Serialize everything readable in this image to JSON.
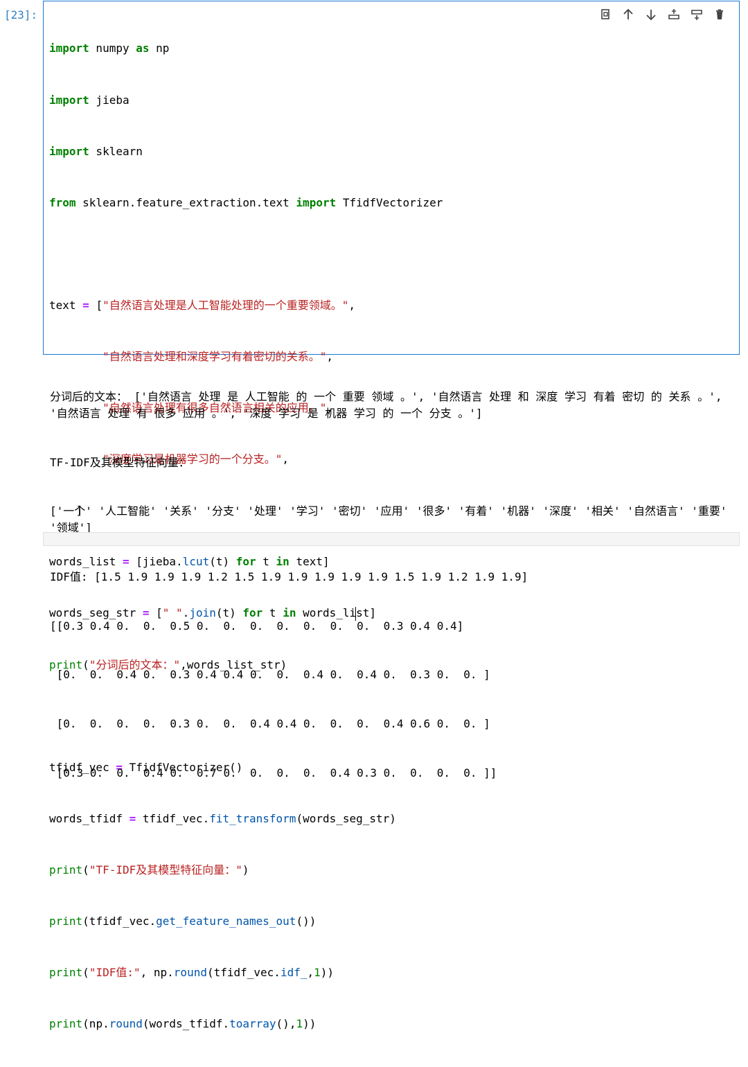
{
  "cell": {
    "prompt": "[23]:",
    "code_lines": [
      "import numpy as np",
      "import jieba",
      "import sklearn",
      "from sklearn.feature_extraction.text import TfidfVectorizer",
      "",
      "text = [\"自然语言处理是人工智能处理的一个重要领域。\",",
      "        \"自然语言处理和深度学习有着密切的关系。\",",
      "        \"自然语言处理有很多自然语言相关的应用。\",",
      "        \"深度学习是机器学习的一个分支。\",",
      "    ]",
      "words_list = [jieba.lcut(t) for t in text]",
      "words_seg_str = [\" \".join(t) for t in words_list]",
      "print(\"分词后的文本：\",words_list_str)",
      "",
      "tfidf_vec = TfidfVectorizer()",
      "words_tfidf = tfidf_vec.fit_transform(words_seg_str)",
      "print(\"TF-IDF及其模型特征向量：\")",
      "print(tfidf_vec.get_feature_names_out())",
      "print(\"IDF值:\", np.round(tfidf_vec.idf_,1))",
      "print(np.round(words_tfidf.toarray(),1))"
    ]
  },
  "toolbar": {
    "icons": [
      "copy-icon",
      "move-up-icon",
      "move-down-icon",
      "insert-above-icon",
      "insert-below-icon",
      "delete-icon"
    ]
  },
  "output": {
    "lines": [
      "分词后的文本： ['自然语言 处理 是 人工智能 的 一个 重要 领域 。', '自然语言 处理 和 深度 学习 有着 密切 的 关系 。', '自然语言 处理 有 很多 应用 。', '深度 学习 是 机器 学习 的 一个 分支 。']",
      "TF-IDF及其模型特征向量：",
      "['一个' '人工智能' '关系' '分支' '处理' '学习' '密切' '应用' '很多' '有着' '机器' '深度' '相关' '自然语言' '重要' '领域']",
      "IDF值: [1.5 1.9 1.9 1.9 1.2 1.5 1.9 1.9 1.9 1.9 1.9 1.5 1.9 1.2 1.9 1.9]",
      "[[0.3 0.4 0.  0.  0.5 0.  0.  0.  0.  0.  0.  0.  0.3 0.4 0.4]",
      " [0.  0.  0.4 0.  0.3 0.4 0.4 0.  0.  0.4 0.  0.4 0.  0.3 0.  0. ]",
      " [0.  0.  0.  0.  0.3 0.  0.  0.4 0.4 0.  0.  0.  0.4 0.6 0.  0. ]",
      " [0.3 0.  0.  0.4 0.  0.7 0.  0.  0.  0.  0.4 0.3 0.  0.  0.  0. ]]"
    ]
  }
}
